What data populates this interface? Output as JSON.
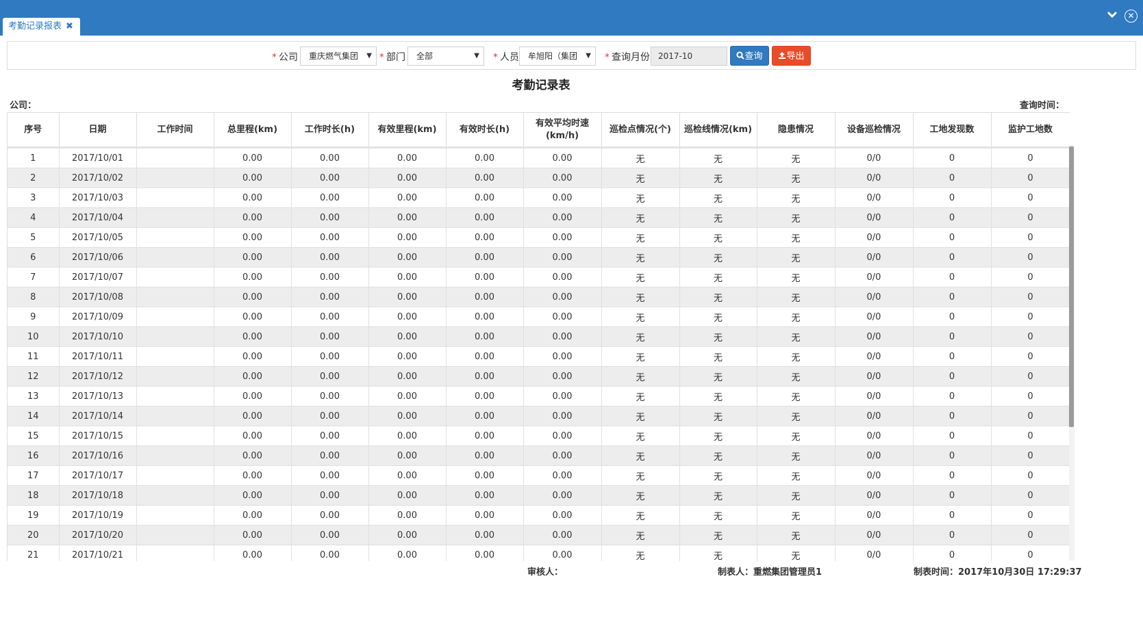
{
  "tab": {
    "label": "考勤记录报表",
    "close_icon": "✖"
  },
  "window": {
    "collapse_icon": "❯",
    "close_icon": "✕"
  },
  "filters": {
    "company_label": "公司",
    "company_value": "重庆燃气集团",
    "dept_label": "部门",
    "dept_value": "全部",
    "person_label": "人员",
    "person_value": "牟旭阳（集团",
    "month_label": "查询月份",
    "month_value": "2017-10",
    "query_button": "查询",
    "export_button": "导出",
    "required_mark": "*"
  },
  "report": {
    "title": "考勤记录表",
    "company_label": "公司：",
    "query_time_label": "查询时间："
  },
  "table": {
    "headers": [
      "序号",
      "日期",
      "工作时间",
      "总里程(km)",
      "工作时长(h)",
      "有效里程(km)",
      "有效时长(h)",
      "有效平均时速\n(km/h)",
      "巡检点情况(个)",
      "巡检线情况(km)",
      "隐患情况",
      "设备巡检情况",
      "工地发现数",
      "监护工地数"
    ],
    "rows": [
      [
        "1",
        "2017/10/01",
        "",
        "0.00",
        "0.00",
        "0.00",
        "0.00",
        "0.00",
        "无",
        "无",
        "无",
        "0/0",
        "0",
        "0"
      ],
      [
        "2",
        "2017/10/02",
        "",
        "0.00",
        "0.00",
        "0.00",
        "0.00",
        "0.00",
        "无",
        "无",
        "无",
        "0/0",
        "0",
        "0"
      ],
      [
        "3",
        "2017/10/03",
        "",
        "0.00",
        "0.00",
        "0.00",
        "0.00",
        "0.00",
        "无",
        "无",
        "无",
        "0/0",
        "0",
        "0"
      ],
      [
        "4",
        "2017/10/04",
        "",
        "0.00",
        "0.00",
        "0.00",
        "0.00",
        "0.00",
        "无",
        "无",
        "无",
        "0/0",
        "0",
        "0"
      ],
      [
        "5",
        "2017/10/05",
        "",
        "0.00",
        "0.00",
        "0.00",
        "0.00",
        "0.00",
        "无",
        "无",
        "无",
        "0/0",
        "0",
        "0"
      ],
      [
        "6",
        "2017/10/06",
        "",
        "0.00",
        "0.00",
        "0.00",
        "0.00",
        "0.00",
        "无",
        "无",
        "无",
        "0/0",
        "0",
        "0"
      ],
      [
        "7",
        "2017/10/07",
        "",
        "0.00",
        "0.00",
        "0.00",
        "0.00",
        "0.00",
        "无",
        "无",
        "无",
        "0/0",
        "0",
        "0"
      ],
      [
        "8",
        "2017/10/08",
        "",
        "0.00",
        "0.00",
        "0.00",
        "0.00",
        "0.00",
        "无",
        "无",
        "无",
        "0/0",
        "0",
        "0"
      ],
      [
        "9",
        "2017/10/09",
        "",
        "0.00",
        "0.00",
        "0.00",
        "0.00",
        "0.00",
        "无",
        "无",
        "无",
        "0/0",
        "0",
        "0"
      ],
      [
        "10",
        "2017/10/10",
        "",
        "0.00",
        "0.00",
        "0.00",
        "0.00",
        "0.00",
        "无",
        "无",
        "无",
        "0/0",
        "0",
        "0"
      ],
      [
        "11",
        "2017/10/11",
        "",
        "0.00",
        "0.00",
        "0.00",
        "0.00",
        "0.00",
        "无",
        "无",
        "无",
        "0/0",
        "0",
        "0"
      ],
      [
        "12",
        "2017/10/12",
        "",
        "0.00",
        "0.00",
        "0.00",
        "0.00",
        "0.00",
        "无",
        "无",
        "无",
        "0/0",
        "0",
        "0"
      ],
      [
        "13",
        "2017/10/13",
        "",
        "0.00",
        "0.00",
        "0.00",
        "0.00",
        "0.00",
        "无",
        "无",
        "无",
        "0/0",
        "0",
        "0"
      ],
      [
        "14",
        "2017/10/14",
        "",
        "0.00",
        "0.00",
        "0.00",
        "0.00",
        "0.00",
        "无",
        "无",
        "无",
        "0/0",
        "0",
        "0"
      ],
      [
        "15",
        "2017/10/15",
        "",
        "0.00",
        "0.00",
        "0.00",
        "0.00",
        "0.00",
        "无",
        "无",
        "无",
        "0/0",
        "0",
        "0"
      ],
      [
        "16",
        "2017/10/16",
        "",
        "0.00",
        "0.00",
        "0.00",
        "0.00",
        "0.00",
        "无",
        "无",
        "无",
        "0/0",
        "0",
        "0"
      ],
      [
        "17",
        "2017/10/17",
        "",
        "0.00",
        "0.00",
        "0.00",
        "0.00",
        "0.00",
        "无",
        "无",
        "无",
        "0/0",
        "0",
        "0"
      ],
      [
        "18",
        "2017/10/18",
        "",
        "0.00",
        "0.00",
        "0.00",
        "0.00",
        "0.00",
        "无",
        "无",
        "无",
        "0/0",
        "0",
        "0"
      ],
      [
        "19",
        "2017/10/19",
        "",
        "0.00",
        "0.00",
        "0.00",
        "0.00",
        "0.00",
        "无",
        "无",
        "无",
        "0/0",
        "0",
        "0"
      ],
      [
        "20",
        "2017/10/20",
        "",
        "0.00",
        "0.00",
        "0.00",
        "0.00",
        "0.00",
        "无",
        "无",
        "无",
        "0/0",
        "0",
        "0"
      ],
      [
        "21",
        "2017/10/21",
        "",
        "0.00",
        "0.00",
        "0.00",
        "0.00",
        "0.00",
        "无",
        "无",
        "无",
        "0/0",
        "0",
        "0"
      ]
    ]
  },
  "footer": {
    "reviewer": "审核人：",
    "creator": "制表人：重燃集团管理员1",
    "created_time": "制表时间：2017年10月30日 17:29:37"
  },
  "colors": {
    "header_blue": "#2f7ac0",
    "export_red": "#e84d2a",
    "required_red": "#e23b3b",
    "stripe": "#ededed"
  },
  "icons": {
    "search": "search-icon",
    "export": "export-icon",
    "dropdown": "caret-down-icon"
  }
}
